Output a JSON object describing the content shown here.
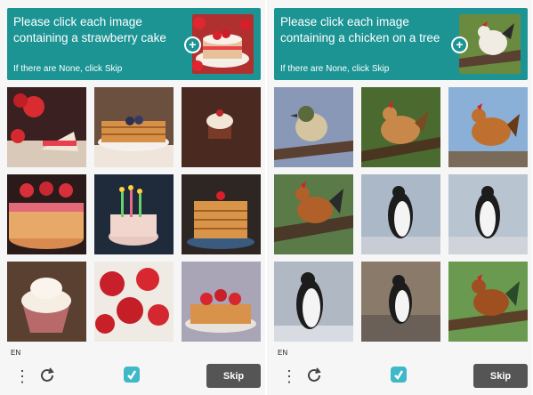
{
  "captchas": [
    {
      "prompt": "Please click each image containing a strawberry cake",
      "skip_hint": "If there are None, click Skip",
      "example_subject": "strawberry cake",
      "grid_subjects": [
        "strawberry cake slice",
        "pancake stack with blueberries",
        "cupcake",
        "strawberry cake",
        "birthday cake with candles",
        "pancake stack with cherry",
        "cupcake with cream",
        "strawberries",
        "pancake stack with strawberries"
      ],
      "language": "EN",
      "skip_label": "Skip"
    },
    {
      "prompt": "Please click each image containing a chicken on a tree",
      "skip_hint": "If there are None, click Skip",
      "example_subject": "chicken on a tree",
      "grid_subjects": [
        "bird on branch",
        "chicken on tree",
        "chicken on roof",
        "chicken on tree branch",
        "penguin",
        "penguin",
        "penguin",
        "penguin",
        "chicken on tree"
      ],
      "language": "EN",
      "skip_label": "Skip"
    }
  ],
  "icons": {
    "menu": "more-vertical-icon",
    "refresh": "refresh-icon",
    "logo": "hcaptcha-logo-icon",
    "plus": "plus-icon"
  },
  "colors": {
    "accent": "#1c9494",
    "skip_button": "#555555",
    "panel_background": "#f6f6f6"
  }
}
